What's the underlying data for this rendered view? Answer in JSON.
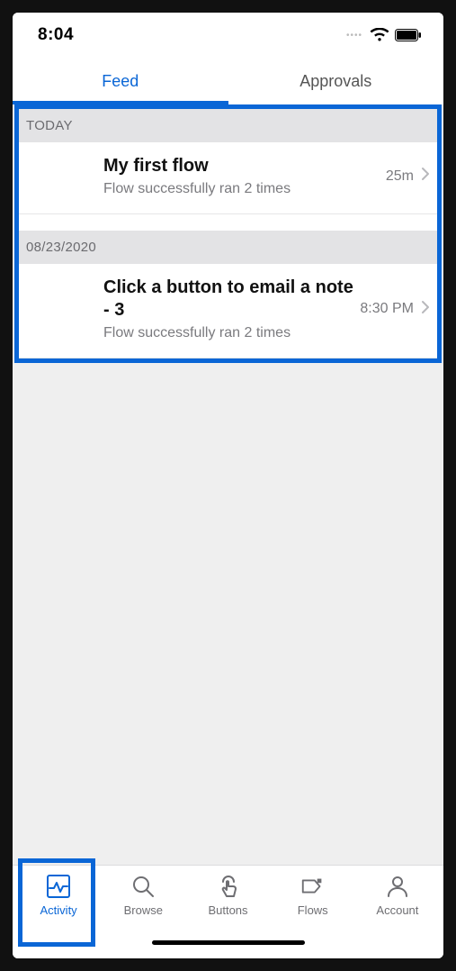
{
  "status": {
    "time": "8:04"
  },
  "tabs": {
    "feed": "Feed",
    "approvals": "Approvals",
    "activeIndex": 0
  },
  "sections": [
    {
      "label": "TODAY",
      "items": [
        {
          "title": "My first flow",
          "subtitle": "Flow successfully ran 2 times",
          "meta": "25m"
        }
      ]
    },
    {
      "label": "08/23/2020",
      "items": [
        {
          "title": "Click a button to email a note - 3",
          "subtitle": "Flow successfully ran 2 times",
          "meta": "8:30 PM"
        }
      ]
    }
  ],
  "nav": {
    "activity": "Activity",
    "browse": "Browse",
    "buttons": "Buttons",
    "flows": "Flows",
    "account": "Account",
    "activeIndex": 0
  }
}
